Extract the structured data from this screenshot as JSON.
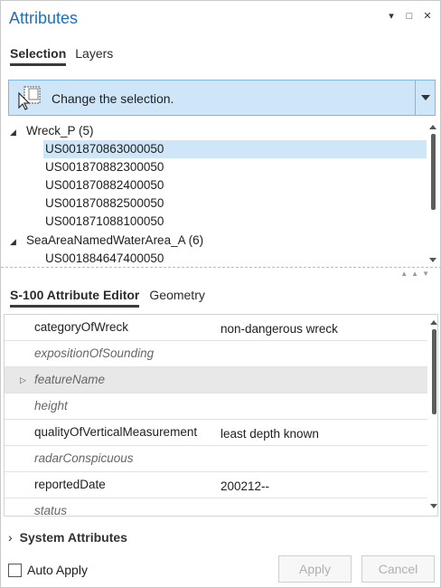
{
  "window": {
    "title": "Attributes",
    "controls": {
      "menu": "▾",
      "restore": "□",
      "close": "✕"
    }
  },
  "tabs_top": [
    {
      "label": "Selection",
      "active": true
    },
    {
      "label": "Layers",
      "active": false
    }
  ],
  "selection_bar": {
    "text": "Change the selection.",
    "icon": "select-cursor-icon",
    "dropdown": "▾"
  },
  "tree": {
    "groups": [
      {
        "label": "Wreck_P (5)",
        "items": [
          "US001870863000050",
          "US001870882300050",
          "US001870882400050",
          "US001870882500050",
          "US001871088100050"
        ],
        "selected_index": 0
      },
      {
        "label": "SeaAreaNamedWaterArea_A (6)",
        "items": [
          "US001884647400050"
        ]
      }
    ]
  },
  "tabs_bottom": [
    {
      "label": "S-100 Attribute Editor",
      "active": true
    },
    {
      "label": "Geometry",
      "active": false
    }
  ],
  "attributes": [
    {
      "name": "categoryOfWreck",
      "value": "non-dangerous wreck",
      "empty": false
    },
    {
      "name": "expositionOfSounding",
      "value": "",
      "empty": true
    },
    {
      "name": "featureName",
      "value": "",
      "empty": true,
      "expandable": true,
      "highlight": true
    },
    {
      "name": "height",
      "value": "",
      "empty": true
    },
    {
      "name": "qualityOfVerticalMeasurement",
      "value": "least depth known",
      "empty": false
    },
    {
      "name": "radarConspicuous",
      "value": "",
      "empty": true
    },
    {
      "name": "reportedDate",
      "value": "200212--",
      "empty": false
    },
    {
      "name": "status",
      "value": "",
      "empty": true
    }
  ],
  "system_attributes": {
    "label": "System Attributes"
  },
  "footer": {
    "auto_apply": "Auto Apply",
    "apply": "Apply",
    "cancel": "Cancel"
  },
  "colors": {
    "accent": "#1f6fba",
    "selection": "#cfe6f8"
  }
}
